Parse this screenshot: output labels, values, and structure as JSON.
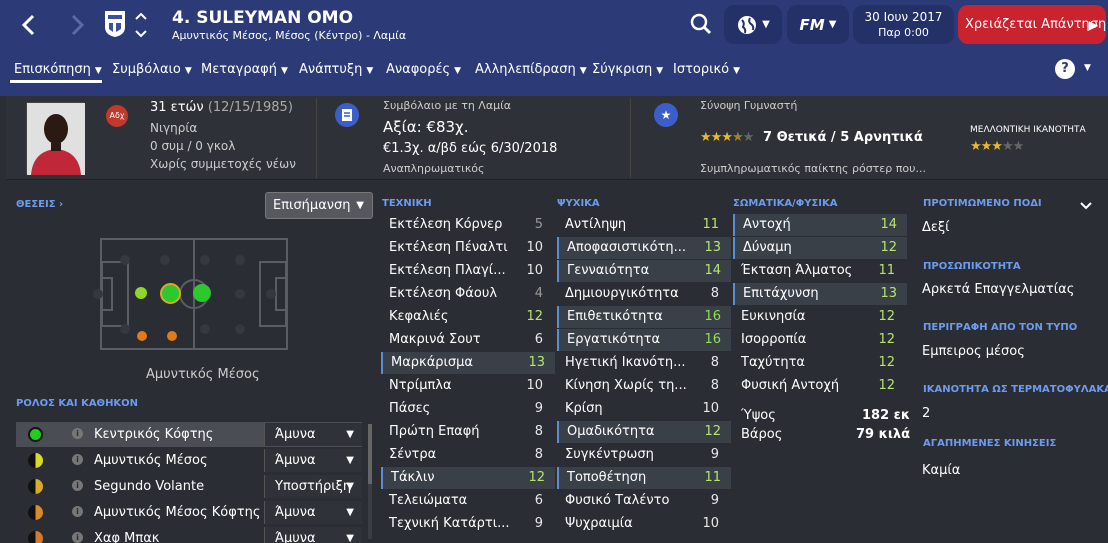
{
  "header": {
    "player_name": "4. SULEYMAN OMO",
    "player_subtitle": "Αμυντικός Μέσος, Μέσος (Κέντρο) - Λαμία",
    "date_line1": "30 Ιουν 2017",
    "date_line2": "Παρ 0:00",
    "alert_text": "Χρειάζεται Απάντηση",
    "fm_label": "FM"
  },
  "tabs": [
    {
      "label": "Επισκόπηση"
    },
    {
      "label": "Συμβόλαιο"
    },
    {
      "label": "Μεταγραφή"
    },
    {
      "label": "Ανάπτυξη"
    },
    {
      "label": "Αναφορές"
    },
    {
      "label": "Αλληλεπίδραση"
    },
    {
      "label": "Σύγκριση"
    },
    {
      "label": "Ιστορικό"
    }
  ],
  "help_label": "?",
  "info": {
    "club_badge_text": "Αδχ",
    "age": "31 ετών",
    "dob": "(12/15/1985)",
    "nationality": "Νιγηρία",
    "caps": "0 συμ / 0 γκολ",
    "youth": "Χωρίς συμμετοχές νέων",
    "contract_title": "Συμβόλαιο με τη Λαμία",
    "value": "Αξία: €83χ.",
    "wage": "€1.3χ. α/βδ εώς 6/30/2018",
    "contract_role": "Αναπληρωματικός",
    "coach_title": "Σύνοψη Γυμναστή",
    "coach_summary": "7 Θετικά / 5 Αρνητικά",
    "coach_note": "Συμπληρωματικός παίκτης ρόστερ που...",
    "potential_label": "ΜΕΛΛΟΝΤΙΚΗ ΙΚΑΝΟΤΗΤΑ",
    "ability_stars": 3,
    "potential_stars": 3
  },
  "positions": {
    "header": "ΘΕΣΕΙΣ",
    "highlight_label": "Επισήμανση",
    "position_name": "Αμυντικός Μέσος"
  },
  "roles": {
    "header": "ΡΟΛΟΣ ΚΑΙ ΚΑΘΗΚΟΝ",
    "items": [
      {
        "name": "Κεντρικός Κόφτης",
        "duty": "Άμυνα",
        "color": "#22cc22"
      },
      {
        "name": "Αμυντικός Μέσος",
        "duty": "Άμυνα",
        "color": "#d9d92a"
      },
      {
        "name": "Segundo Volante",
        "duty": "Υποστήριξη",
        "color": "#d9a92a"
      },
      {
        "name": "Αμυντικός Μέσος Κόφτης",
        "duty": "Άμυνα",
        "color": "#d98a2a"
      },
      {
        "name": "Χαφ Μπακ",
        "duty": "Άμυνα",
        "color": "#d9782a"
      }
    ]
  },
  "technical": {
    "header": "ΤΕΧΝΙΚΗ",
    "items": [
      {
        "name": "Εκτέλεση Κόρνερ",
        "value": "5"
      },
      {
        "name": "Εκτέλεση Πέναλτι",
        "value": "10"
      },
      {
        "name": "Εκτέλεση Πλαγί...",
        "value": "10"
      },
      {
        "name": "Εκτέλεση Φάουλ",
        "value": "4"
      },
      {
        "name": "Κεφαλιές",
        "value": "12"
      },
      {
        "name": "Μακρινά Σουτ",
        "value": "6"
      },
      {
        "name": "Μαρκάρισμα",
        "value": "13"
      },
      {
        "name": "Ντρίμπλα",
        "value": "10"
      },
      {
        "name": "Πάσες",
        "value": "9"
      },
      {
        "name": "Πρώτη Επαφή",
        "value": "8"
      },
      {
        "name": "Σέντρα",
        "value": "8"
      },
      {
        "name": "Τάκλιν",
        "value": "12"
      },
      {
        "name": "Τελειώματα",
        "value": "6"
      },
      {
        "name": "Τεχνική Κατάρτι...",
        "value": "9"
      }
    ]
  },
  "mental": {
    "header": "ΨΥΧΙΚΑ",
    "items": [
      {
        "name": "Αντίληψη",
        "value": "11"
      },
      {
        "name": "Αποφασιστικότη...",
        "value": "13"
      },
      {
        "name": "Γενναιότητα",
        "value": "14"
      },
      {
        "name": "Δημιουργικότητα",
        "value": "8"
      },
      {
        "name": "Επιθετικότητα",
        "value": "16"
      },
      {
        "name": "Εργατικότητα",
        "value": "16"
      },
      {
        "name": "Ηγετική Ικανότη...",
        "value": "8"
      },
      {
        "name": "Κίνηση Χωρίς τη...",
        "value": "8"
      },
      {
        "name": "Κρίση",
        "value": "10"
      },
      {
        "name": "Ομαδικότητα",
        "value": "12"
      },
      {
        "name": "Συγκέντρωση",
        "value": "9"
      },
      {
        "name": "Τοποθέτηση",
        "value": "11"
      },
      {
        "name": "Φυσικό Ταλέντο",
        "value": "9"
      },
      {
        "name": "Ψυχραιμία",
        "value": "10"
      }
    ]
  },
  "physical": {
    "header": "ΣΩΜΑΤΙΚΑ/ΦΥΣΙΚΑ",
    "items": [
      {
        "name": "Αντοχή",
        "value": "14"
      },
      {
        "name": "Δύναμη",
        "value": "12"
      },
      {
        "name": "Έκταση Άλματος",
        "value": "11"
      },
      {
        "name": "Επιτάχυνση",
        "value": "13"
      },
      {
        "name": "Ευκινησία",
        "value": "12"
      },
      {
        "name": "Ισορροπία",
        "value": "12"
      },
      {
        "name": "Ταχύτητα",
        "value": "12"
      },
      {
        "name": "Φυσική Αντοχή",
        "value": "12"
      }
    ],
    "height_label": "Ύψος",
    "height_value": "182 εκ",
    "weight_label": "Βάρος",
    "weight_value": "79 κιλά"
  },
  "right_info": {
    "foot_header": "ΠΡΟΤΙΜΩΜΕΝΟ ΠΟΔΙ",
    "foot_value": "Δεξί",
    "personality_header": "ΠΡΟΣΩΠΙΚΟΤΗΤΑ",
    "personality_value": "Αρκετά Επαγγελματίας",
    "media_header": "ΠΕΡΙΓΡΑΦΗ ΑΠΟ ΤΟΝ ΤΥΠΟ",
    "media_value": "Εμπειρος μέσος",
    "gk_header": "ΙΚΑΝΟΤΗΤΑ ΩΣ ΤΕΡΜΑΤΟΦΥΛΑΚΑΣ",
    "gk_value": "2",
    "moves_header": "ΑΓΑΠΗΜΕΝΕΣ ΚΙΝΗΣΕΙΣ",
    "moves_value": "Καμία"
  }
}
